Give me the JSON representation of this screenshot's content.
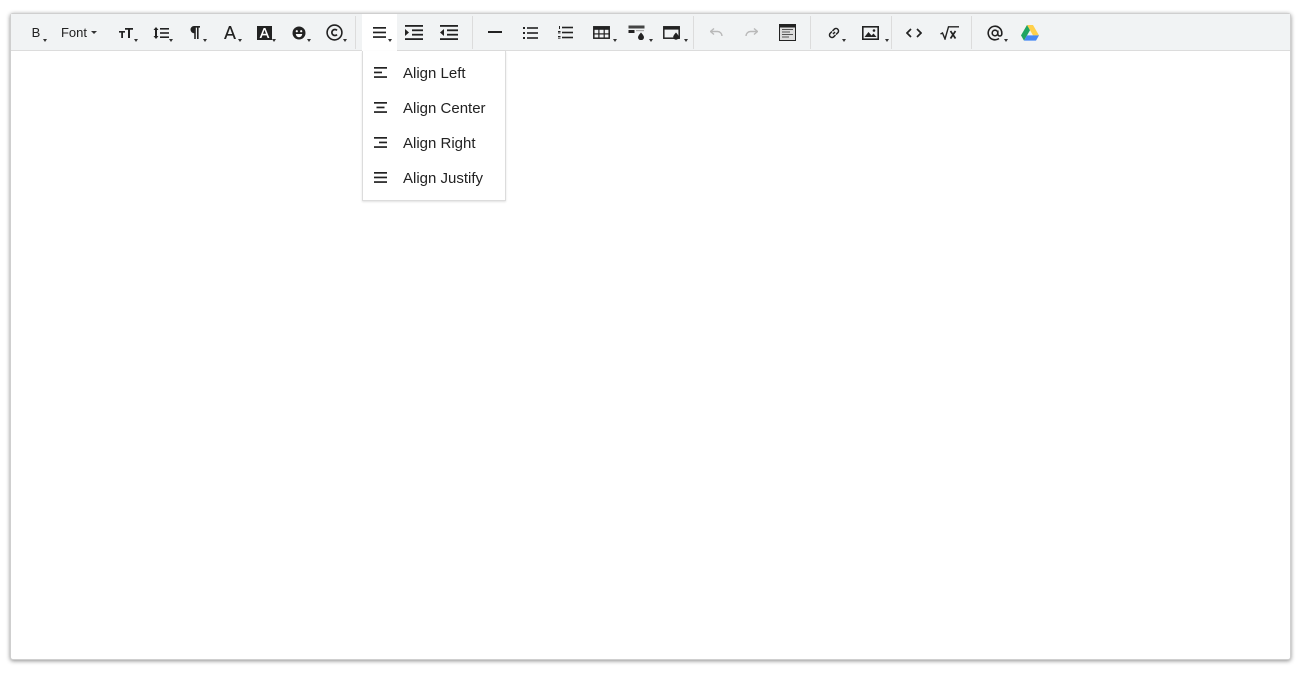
{
  "toolbar": {
    "bold_label": "B",
    "font_label": "Font",
    "buttons": [
      {
        "name": "bold-button",
        "icon": "bold-icon"
      },
      {
        "name": "font-select",
        "icon": "font-icon"
      },
      {
        "name": "font-size-button",
        "icon": "font-size-icon"
      },
      {
        "name": "line-height-button",
        "icon": "line-height-icon"
      },
      {
        "name": "paragraph-format-button",
        "icon": "paragraph-icon"
      },
      {
        "name": "text-color-button",
        "icon": "text-color-icon"
      },
      {
        "name": "background-color-button",
        "icon": "highlight-icon"
      },
      {
        "name": "emoji-button",
        "icon": "emoji-icon"
      },
      {
        "name": "special-chars-button",
        "icon": "copyright-icon"
      },
      {
        "name": "align-button",
        "icon": "align-justify-icon"
      },
      {
        "name": "indent-button",
        "icon": "indent-icon"
      },
      {
        "name": "outdent-button",
        "icon": "outdent-icon"
      },
      {
        "name": "horizontal-rule-button",
        "icon": "horizontal-rule-icon"
      },
      {
        "name": "bulleted-list-button",
        "icon": "bulleted-list-icon"
      },
      {
        "name": "numbered-list-button",
        "icon": "numbered-list-icon"
      },
      {
        "name": "table-button",
        "icon": "table-icon"
      },
      {
        "name": "cell-color-button",
        "icon": "cell-fill-icon"
      },
      {
        "name": "block-color-button",
        "icon": "block-fill-icon"
      },
      {
        "name": "undo-button",
        "icon": "undo-icon"
      },
      {
        "name": "redo-button",
        "icon": "redo-icon"
      },
      {
        "name": "source-view-button",
        "icon": "source-view-icon"
      },
      {
        "name": "link-button",
        "icon": "link-icon"
      },
      {
        "name": "image-button",
        "icon": "image-icon"
      },
      {
        "name": "code-button",
        "icon": "code-icon"
      },
      {
        "name": "math-button",
        "icon": "square-root-icon"
      },
      {
        "name": "mention-button",
        "icon": "at-icon"
      },
      {
        "name": "google-drive-button",
        "icon": "google-drive-icon"
      }
    ]
  },
  "align_menu": {
    "items": [
      {
        "label": "Align Left",
        "icon": "align-left-icon"
      },
      {
        "label": "Align Center",
        "icon": "align-center-icon"
      },
      {
        "label": "Align Right",
        "icon": "align-right-icon"
      },
      {
        "label": "Align Justify",
        "icon": "align-justify-icon"
      }
    ]
  },
  "colors": {
    "toolbar_bg": "#f1f3f4",
    "icon": "#222222",
    "disabled_icon": "#b9b9b9",
    "drive_green": "#1fa463",
    "drive_yellow": "#ffd04b",
    "drive_blue": "#4688f4"
  }
}
